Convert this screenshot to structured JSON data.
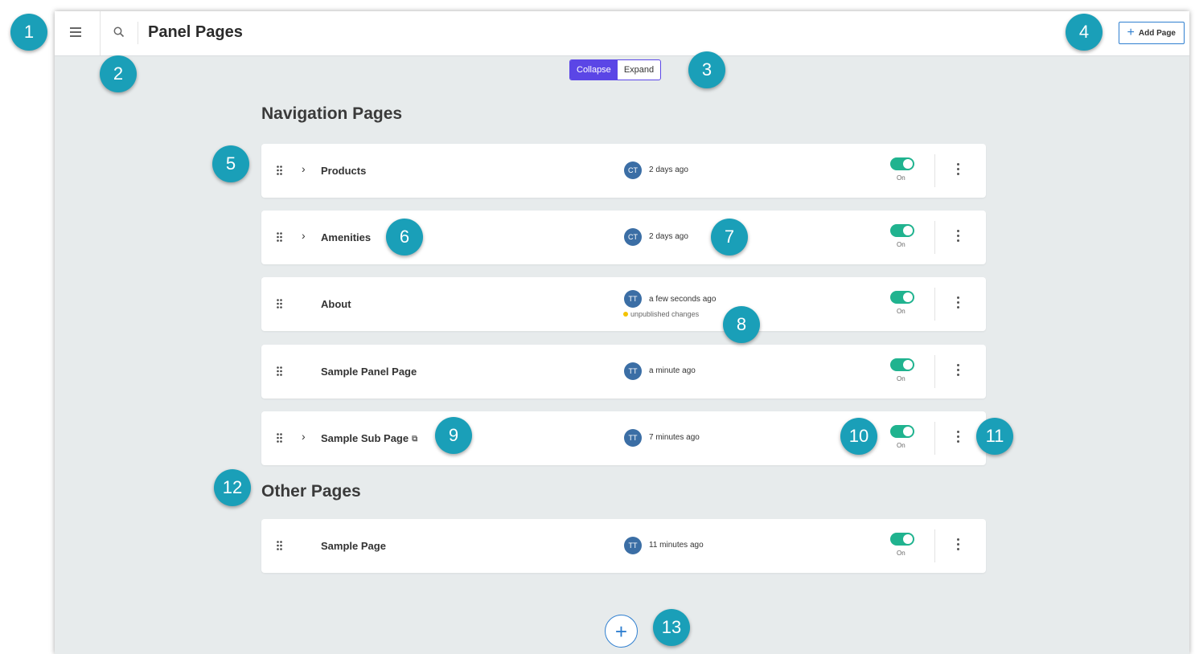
{
  "header": {
    "title": "Panel Pages",
    "add_page_label": "Add Page",
    "add_page_plus": "+"
  },
  "view_toggle": {
    "collapse": "Collapse",
    "expand": "Expand"
  },
  "sections": {
    "navigation": {
      "title": "Navigation Pages",
      "rows": [
        {
          "name": "Products",
          "initials": "CT",
          "time": "2 days ago",
          "status": "On"
        },
        {
          "name": "Amenities",
          "initials": "CT",
          "time": "2 days ago",
          "status": "On"
        },
        {
          "name": "About",
          "initials": "TT",
          "time": "a few seconds ago",
          "note": "unpublished changes",
          "status": "On"
        },
        {
          "name": "Sample Panel Page",
          "initials": "TT",
          "time": "a minute ago",
          "status": "On"
        },
        {
          "name": "Sample Sub Page",
          "initials": "TT",
          "time": "7 minutes ago",
          "status": "On"
        }
      ]
    },
    "other": {
      "title": "Other Pages",
      "rows": [
        {
          "name": "Sample Page",
          "initials": "TT",
          "time": "11 minutes ago",
          "status": "On"
        }
      ]
    }
  },
  "fab": {
    "label": "+"
  },
  "callouts": [
    "1",
    "2",
    "3",
    "4",
    "5",
    "6",
    "7",
    "8",
    "9",
    "10",
    "11",
    "12",
    "13"
  ],
  "colors": {
    "accent": "#5b46e6",
    "toggle_on": "#20b38f",
    "avatar": "#3b6ea5",
    "callout": "#1a9fb8",
    "link": "#2f7fd0"
  },
  "icons": [
    "hamburger-icon",
    "search-icon",
    "plus-icon",
    "drag-handle-icon",
    "chevron-right-icon",
    "external-link-icon",
    "kebab-menu-icon"
  ]
}
